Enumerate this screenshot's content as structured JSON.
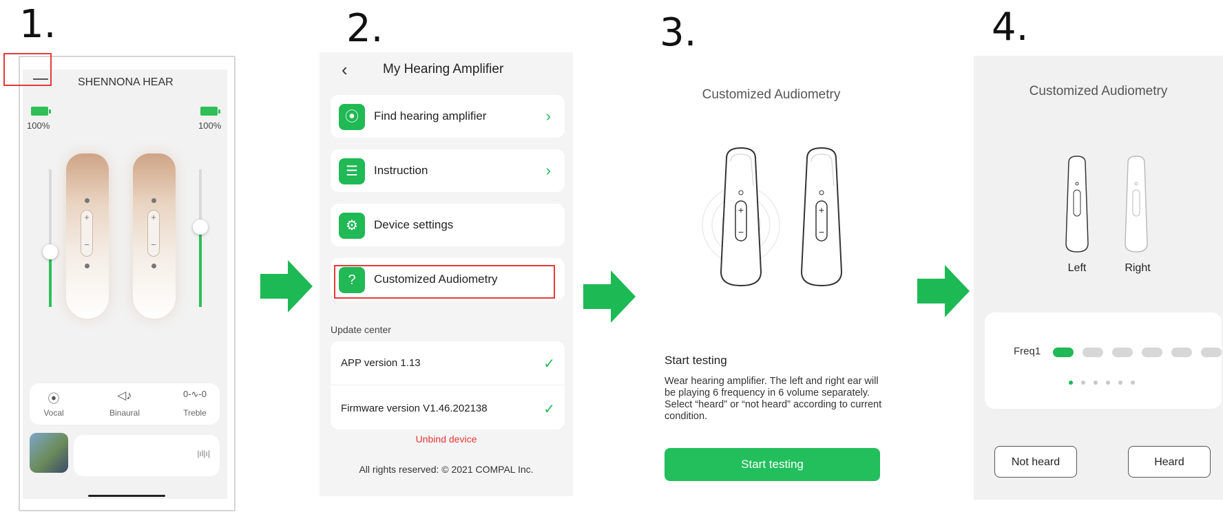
{
  "steps": [
    "1.",
    "2.",
    "3.",
    "4."
  ],
  "colors": {
    "accent_green": "#20b955",
    "highlight_red": "#e53935",
    "unbind_red": "#e53935"
  },
  "panel1": {
    "title": "SHENNONA HEAR",
    "left_battery": "100%",
    "right_battery": "100%",
    "left_volume_fraction": 0.4,
    "right_volume_fraction": 0.58,
    "modes": [
      {
        "label": "Vocal",
        "icon": "vocal-icon"
      },
      {
        "label": "Binaural",
        "icon": "binaural-icon"
      },
      {
        "label": "Treble",
        "icon": "treble-icon"
      }
    ]
  },
  "panel2": {
    "title": "My Hearing Amplifier",
    "menu": [
      {
        "label": "Find hearing amplifier",
        "icon": "location-pin-icon"
      },
      {
        "label": "Instruction",
        "icon": "document-icon"
      },
      {
        "label": "Device settings",
        "icon": "gear-icon"
      },
      {
        "label": "Customized Audiometry",
        "icon": "ear-icon"
      }
    ],
    "update_center": "Update center",
    "app_version": "APP version 1.13",
    "firmware_version": "Firmware version V1.46.202138",
    "unbind": "Unbind device",
    "footer": "All rights reserved: © 2021 COMPAL Inc."
  },
  "panel3": {
    "title": "Customized Audiometry",
    "heading": "Start testing",
    "description": "Wear hearing amplifier. The left and right ear will be playing 6 frequency in 6 volume separately. Select “heard” or “not heard” according to current condition.",
    "button": "Start testing"
  },
  "panel4": {
    "title": "Customized Audiometry",
    "left": "Left",
    "right": "Right",
    "freq_label": "Freq1",
    "active_segment": 1,
    "segment_count": 6,
    "page_dots": 6,
    "not_heard": "Not heard",
    "heard": "Heard"
  }
}
